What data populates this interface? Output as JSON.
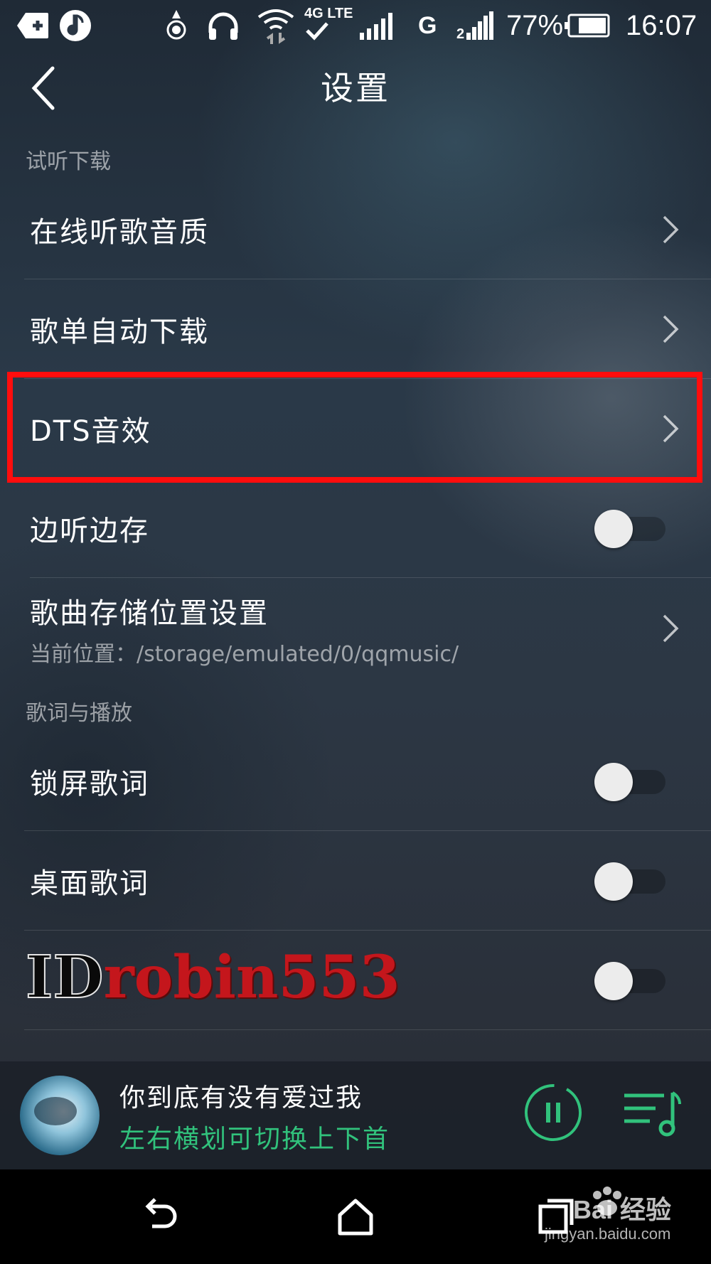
{
  "status_bar": {
    "network_label": "4G LTE",
    "carrier_g": "G",
    "battery": "77%",
    "time": "16:07"
  },
  "header": {
    "title": "设置"
  },
  "sections": [
    {
      "label": "试听下载",
      "rows": [
        {
          "label": "在线听歌音质",
          "control": "chevron"
        },
        {
          "label": "歌单自动下载",
          "control": "chevron"
        },
        {
          "label": "DTS音效",
          "control": "chevron",
          "highlighted": true
        },
        {
          "label": "边听边存",
          "control": "toggle",
          "on": false
        },
        {
          "label": "歌曲存储位置设置",
          "sublabel": "当前位置：/storage/emulated/0/qqmusic/",
          "control": "chevron"
        }
      ]
    },
    {
      "label": "歌词与播放",
      "rows": [
        {
          "label": "锁屏歌词",
          "control": "toggle",
          "on": false
        },
        {
          "label": "桌面歌词",
          "control": "toggle",
          "on": false
        },
        {
          "label": "",
          "control": "toggle",
          "on": false
        }
      ]
    }
  ],
  "watermark": {
    "id_text": "ID",
    "name_text": "robin553"
  },
  "player": {
    "song_title": "你到底有没有爱过我",
    "hint": "左右横划可切换上下首"
  },
  "baidu": {
    "brand": "Bai  经验",
    "url": "jingyan.baidu.com"
  },
  "colors": {
    "accent_green": "#31c27c",
    "highlight_red": "#ff0d0d"
  }
}
